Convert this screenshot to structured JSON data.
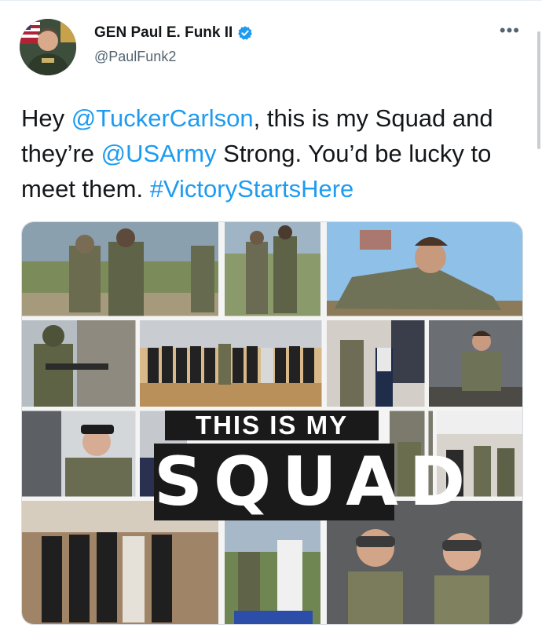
{
  "tweet": {
    "author": {
      "name": "GEN Paul E. Funk II",
      "handle": "@PaulFunk2"
    },
    "more_label": "•••",
    "text": {
      "part1": "Hey ",
      "mention1": "@TuckerCarlson",
      "part2": ", this is my Squad and they’re ",
      "mention2": "@USArmy",
      "part3": " Strong. You’d be lucky to meet them. ",
      "hashtag": "#VictoryStartsHere"
    },
    "media": {
      "overlay_line1": "THIS IS MY",
      "overlay_line2": "SQUAD"
    }
  },
  "colors": {
    "link": "#1d9bf0",
    "verified": "#1d9bf0",
    "handle": "#536471"
  },
  "icons": {
    "verified": "verified-badge-icon",
    "more": "more-options-icon"
  }
}
